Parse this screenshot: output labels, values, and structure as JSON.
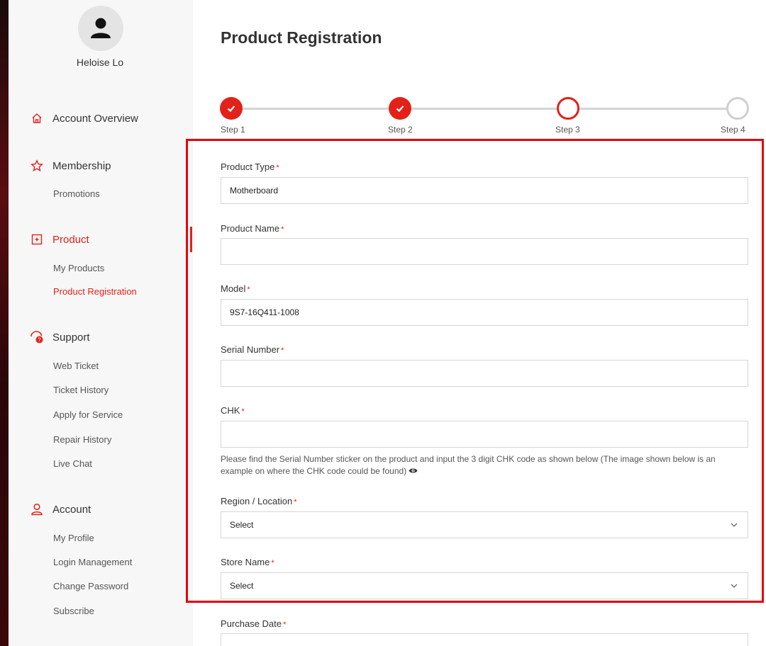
{
  "user": {
    "name": "Heloise Lo"
  },
  "sidebar": {
    "account_overview": "Account Overview",
    "membership": {
      "label": "Membership",
      "items": [
        "Promotions"
      ]
    },
    "product": {
      "label": "Product",
      "items": [
        "My Products",
        "Product Registration"
      ]
    },
    "support": {
      "label": "Support",
      "items": [
        "Web Ticket",
        "Ticket History",
        "Apply for Service",
        "Repair History",
        "Live Chat"
      ]
    },
    "account": {
      "label": "Account",
      "items": [
        "My Profile",
        "Login Management",
        "Change Password",
        "Subscribe"
      ]
    }
  },
  "page": {
    "title": "Product Registration"
  },
  "steps": [
    "Step 1",
    "Step 2",
    "Step 3",
    "Step 4"
  ],
  "form": {
    "product_type": {
      "label": "Product Type",
      "value": "Motherboard"
    },
    "product_name": {
      "label": "Product Name",
      "value": ""
    },
    "model": {
      "label": "Model",
      "value": "9S7-16Q411-1008"
    },
    "serial_number": {
      "label": "Serial Number",
      "value": ""
    },
    "chk": {
      "label": "CHK",
      "value": "",
      "help": "Please find the Serial Number sticker on the product and input the 3 digit CHK code as shown below (The image shown below is an example on where the CHK code could be found)"
    },
    "region": {
      "label": "Region / Location",
      "value": "Select"
    },
    "store_name": {
      "label": "Store Name",
      "value": "Select"
    },
    "purchase_date": {
      "label": "Purchase Date"
    },
    "required_mark": "*"
  },
  "colors": {
    "accent": "#e32119",
    "highlight": "#e3000f",
    "sidebar_bg": "#f7f7f7"
  },
  "icons": {
    "avatar": "user-icon",
    "overview": "home-icon",
    "membership": "star-icon",
    "product": "product-icon",
    "support": "support-chat-icon",
    "account": "person-icon",
    "step_done": "check-icon",
    "select": "chevron-down-icon",
    "help": "eye-icon"
  }
}
